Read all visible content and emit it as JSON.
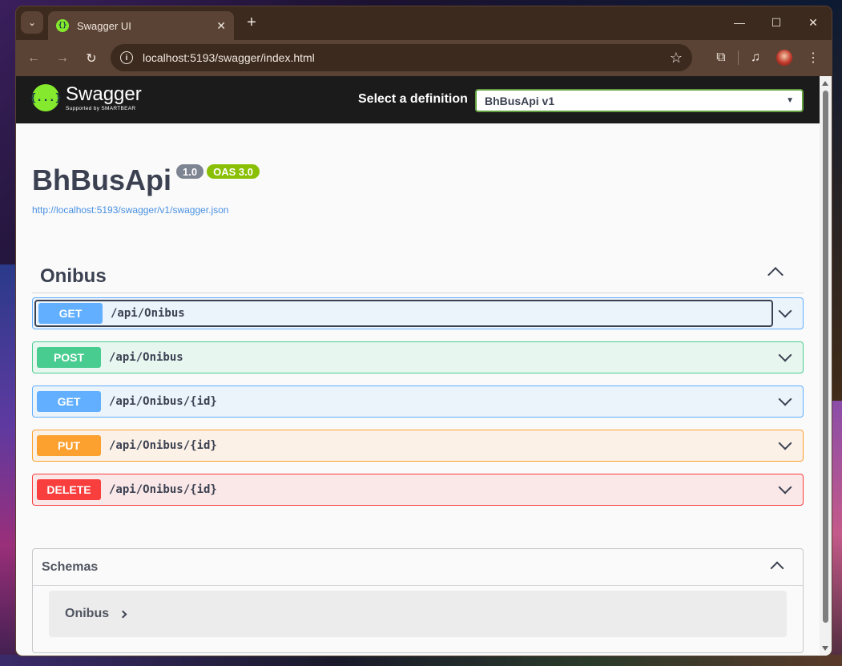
{
  "browser": {
    "tab": {
      "title": "Swagger UI"
    },
    "address": {
      "url": "localhost:5193/swagger/index.html"
    }
  },
  "topbar": {
    "logo_name": "Swagger",
    "logo_sub": "Supported by SMARTBEAR",
    "definition_label": "Select a definition",
    "definition_selected": "BhBusApi v1"
  },
  "info": {
    "title": "BhBusApi",
    "version": "1.0",
    "oas": "OAS 3.0",
    "spec_url": "http://localhost:5193/swagger/v1/swagger.json"
  },
  "tag": {
    "name": "Onibus",
    "operations": [
      {
        "method": "GET",
        "path": "/api/Onibus"
      },
      {
        "method": "POST",
        "path": "/api/Onibus"
      },
      {
        "method": "GET",
        "path": "/api/Onibus/{id}"
      },
      {
        "method": "PUT",
        "path": "/api/Onibus/{id}"
      },
      {
        "method": "DELETE",
        "path": "/api/Onibus/{id}"
      }
    ]
  },
  "schemas": {
    "title": "Schemas",
    "models": [
      {
        "name": "Onibus"
      }
    ]
  },
  "colors": {
    "get": "#61affe",
    "post": "#49cc90",
    "put": "#fca130",
    "delete": "#f93e3e",
    "swagger_green": "#85ea2d"
  }
}
